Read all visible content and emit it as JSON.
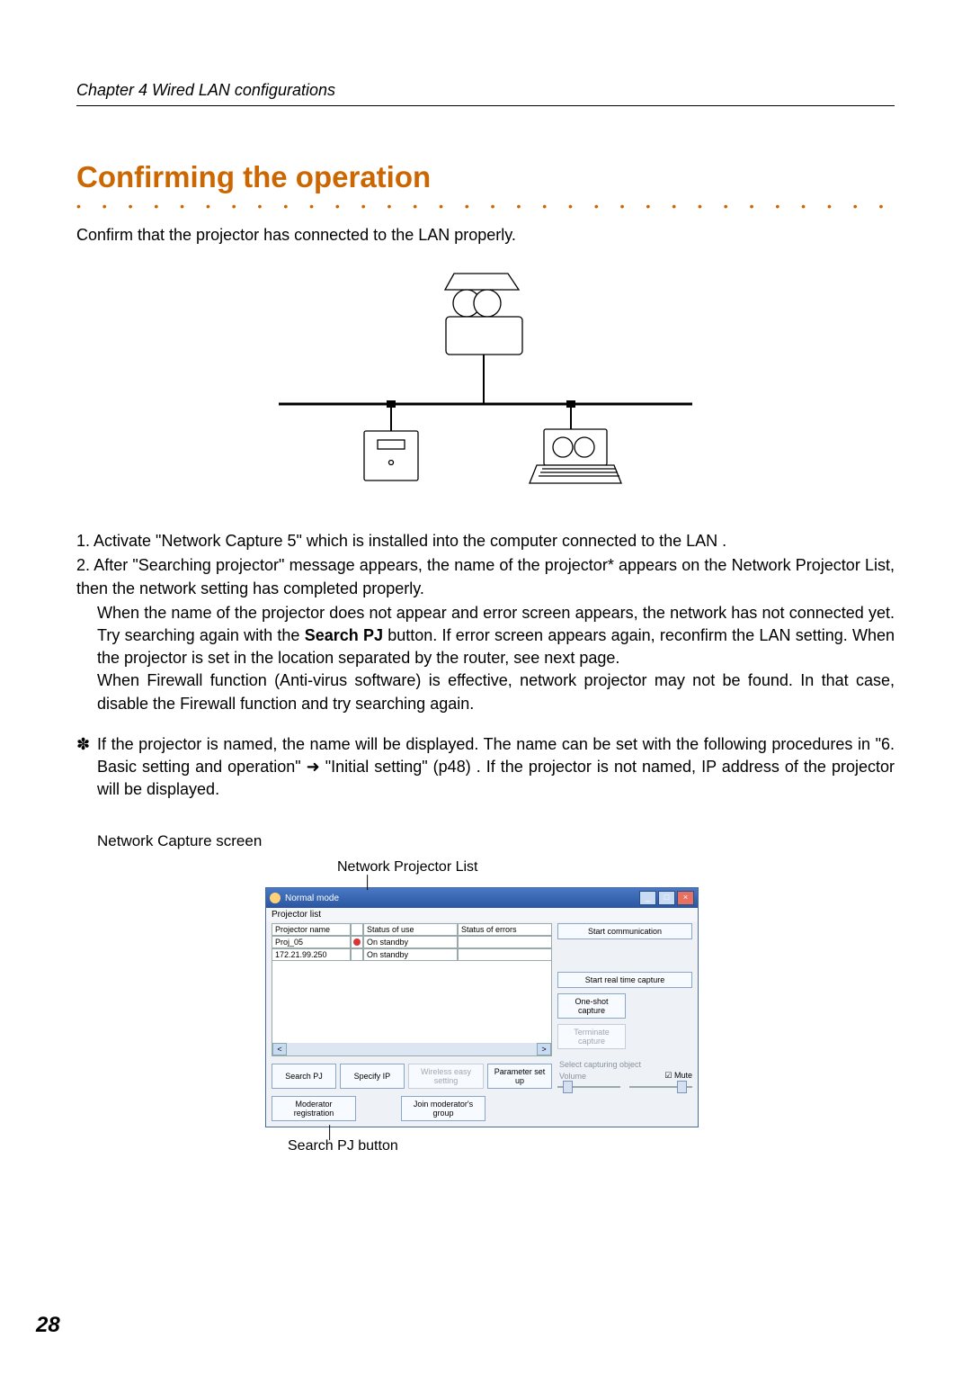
{
  "chapter": "Chapter 4 Wired LAN configurations",
  "section_title": "Confirming the operation",
  "intro": "Confirm that the projector has connected to the LAN properly.",
  "steps": {
    "s1": "1. Activate \"Network Capture 5\" which is installed into the computer connected to the LAN .",
    "s2_lead": "2. After \"Searching projector\" message appears, the name of the projector* appears on the Network Projector List, then the network setting has completed properly.",
    "s2_a_pre": "When the name of the projector does not appear and error screen appears, the network has not connected yet. Try searching again with the ",
    "s2_a_bold": "Search PJ",
    "s2_a_post": " button. If error screen appears again, reconfirm the LAN setting. When the projector is set in the location separated by the router, see next page.",
    "s2_b": "When Firewall function (Anti-virus software) is effective, network projector may not be found.  In that case, disable the Firewall function and try searching again."
  },
  "note_mark": "✽",
  "note_body_pre": "If the projector is named, the name will be displayed. The name can be set with the following procedures in \"6. Basic setting and operation\" ",
  "note_arrow": "➜",
  "note_body_post": " \"Initial setting\" (p48) . If the projector is not named, IP address of the projector will be displayed.",
  "caption_screen": "Network Capture screen",
  "caption_list": "Network Projector List",
  "caption_search": "Search PJ button",
  "page_number": "28",
  "app": {
    "title": "Normal mode",
    "menubar": "Projector list",
    "cols": {
      "name": "Projector name",
      "status": "Status of use",
      "errors": "Status of errors"
    },
    "rows": [
      {
        "name": "Proj_05",
        "status": "On standby",
        "mark": true
      },
      {
        "name": "172.21.99.250",
        "status": "On standby",
        "mark": false
      }
    ],
    "btn_start_comm": "Start communication",
    "btn_start_rt": "Start real time capture",
    "btn_oneshot": "One-shot capture",
    "btn_terminate": "Terminate capture",
    "lbl_select_obj": "Select capturing object",
    "lbl_volume": "Volume",
    "chk_mute": "Mute",
    "btnrow": {
      "searchpj": "Search PJ",
      "specifyip": "Specify IP",
      "wireless": "Wireless easy setting",
      "param": "Parameter set up",
      "modreg": "Moderator registration",
      "joinmod": "Join moderator's group"
    }
  }
}
